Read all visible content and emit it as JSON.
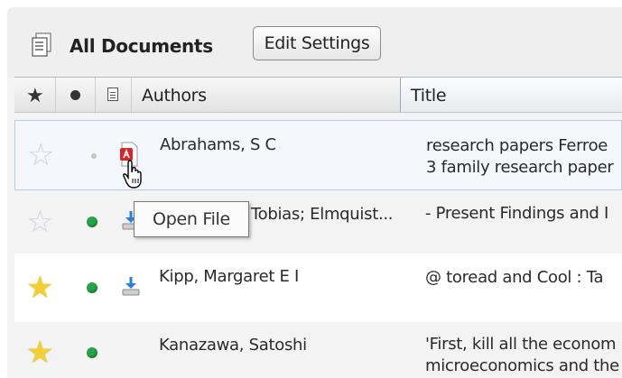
{
  "header": {
    "title": "All Documents",
    "edit_settings_label": "Edit Settings"
  },
  "columns": {
    "star_icon": "star-icon",
    "read_status_icon": "dot-icon",
    "file_icon": "page-icon",
    "authors": "Authors",
    "title": "Title"
  },
  "rows": [
    {
      "starred": false,
      "read_status": "read",
      "file": "pdf",
      "authors": "Abrahams, S C",
      "title_lines": [
        "research papers Ferroe",
        "3 family research paper"
      ]
    },
    {
      "starred": false,
      "read_status": "unread",
      "file": "download",
      "authors": "Tobias; Elmquist...",
      "title_lines": [
        "- Present Findings and I"
      ]
    },
    {
      "starred": true,
      "read_status": "unread",
      "file": "download",
      "authors": "Kipp, Margaret E I",
      "title_lines": [
        "@ toread and Cool : Ta"
      ]
    },
    {
      "starred": true,
      "read_status": "unread",
      "file": "none",
      "authors": "Kanazawa, Satoshi",
      "title_lines": [
        "'First, kill all the econom",
        "microeconomics and the"
      ]
    }
  ],
  "tooltip": {
    "text": "Open File"
  },
  "colors": {
    "accent_selection": "#b8cce6",
    "star_filled": "#f2cf34",
    "unread_dot": "#29a34a",
    "pdf_red": "#d6262b",
    "download_blue": "#2b7fd6"
  }
}
